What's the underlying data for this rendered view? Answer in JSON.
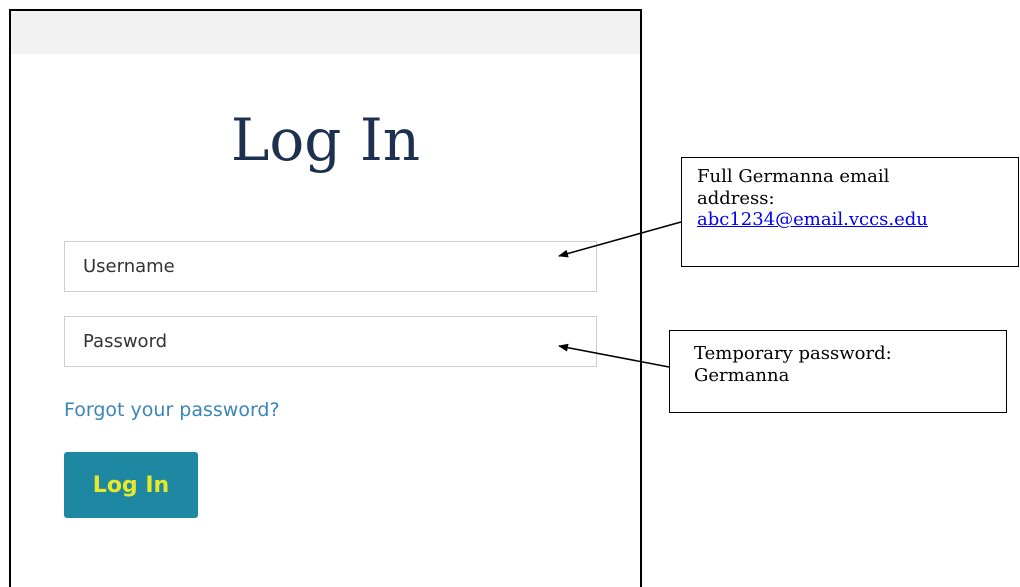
{
  "login": {
    "title": "Log In",
    "username_placeholder": "Username",
    "password_placeholder": "Password",
    "forgot_link": "Forgot your password?",
    "button_label": "Log In"
  },
  "annotations": {
    "email_callout": {
      "line1": "Full Germanna email",
      "line2": "address:",
      "link": "abc1234@email.vccs.edu"
    },
    "password_callout": {
      "line1": "Temporary password:",
      "line2": "Germanna"
    }
  },
  "colors": {
    "title": "#1e3050",
    "link": "#3b86b8",
    "button_bg": "#1e88a2",
    "button_text": "#e8e82a",
    "topbar": "#f2f2f2",
    "callout_link": "#0000ee"
  }
}
